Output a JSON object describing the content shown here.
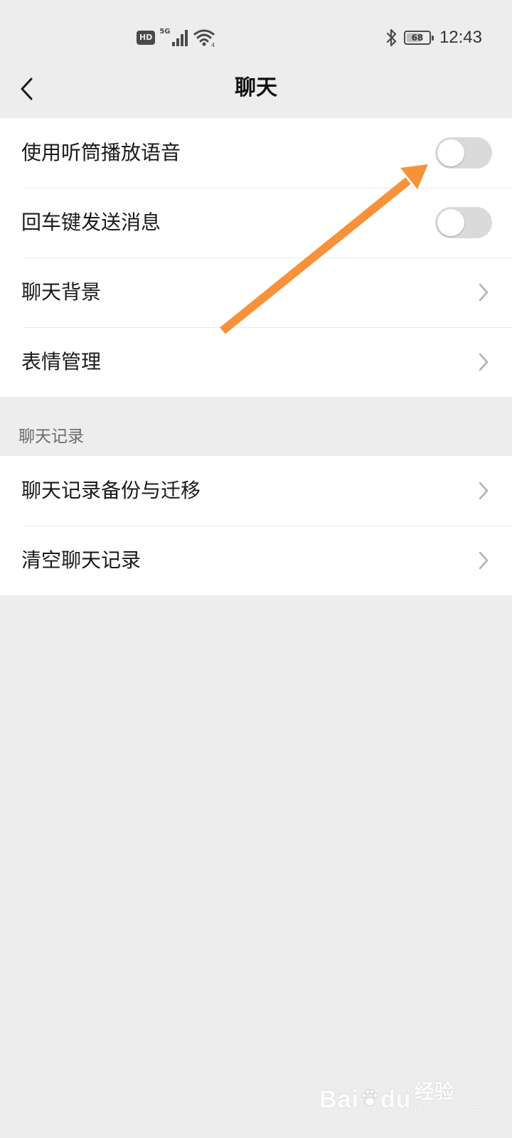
{
  "status_bar": {
    "hd_badge": "HD",
    "network": "5G",
    "battery_level": 68,
    "battery_text": "68",
    "time": "12:43"
  },
  "nav": {
    "title": "聊天"
  },
  "settings_group_1": {
    "items": [
      {
        "label": "使用听筒播放语音",
        "control": "toggle",
        "toggle_on": false
      },
      {
        "label": "回车键发送消息",
        "control": "toggle",
        "toggle_on": false
      },
      {
        "label": "聊天背景",
        "control": "chevron"
      },
      {
        "label": "表情管理",
        "control": "chevron"
      }
    ]
  },
  "section_chat_history": {
    "title": "聊天记录",
    "items": [
      {
        "label": "聊天记录备份与迁移",
        "control": "chevron"
      },
      {
        "label": "清空聊天记录",
        "control": "chevron"
      }
    ]
  },
  "watermark": {
    "brand": "Bai",
    "brand_suffix": "du",
    "sub": "经验",
    "url": "jingyan.baidu.com"
  },
  "colors": {
    "background": "#ededed",
    "card": "#ffffff",
    "toggle_off_track": "#dadada",
    "annotation_arrow": "#f7923a",
    "chevron": "#b2b2b2"
  },
  "icons": {
    "back": "chevron-left-icon",
    "row_arrow": "chevron-right-icon",
    "bluetooth": "bluetooth-icon",
    "wifi": "wifi-icon",
    "signal": "signal-icon"
  }
}
